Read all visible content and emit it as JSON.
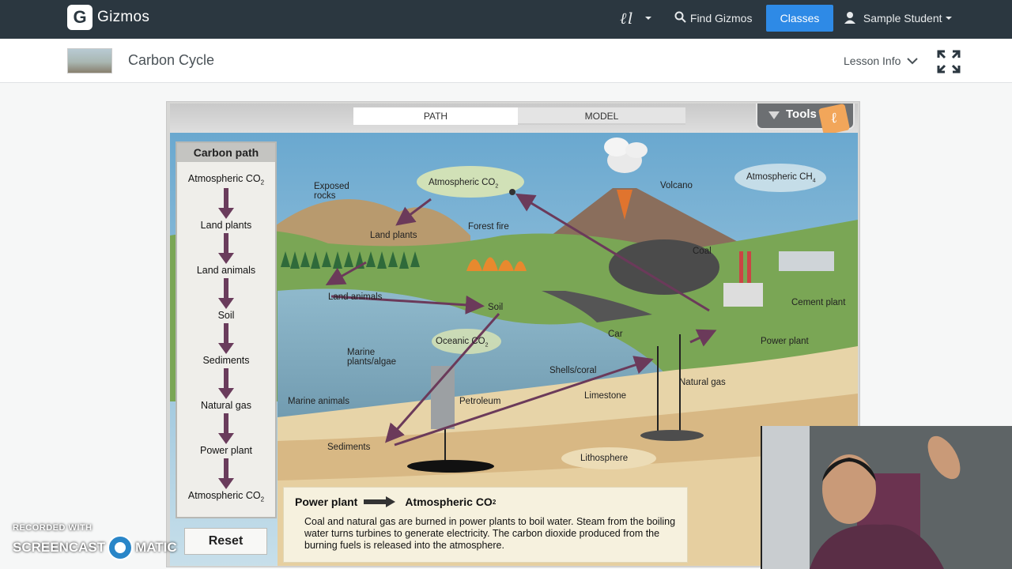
{
  "header": {
    "logo_letter": "G",
    "logo_text": "Gizmos",
    "find_label": "Find Gizmos",
    "classes_label": "Classes",
    "user_label": "Sample Student"
  },
  "subheader": {
    "title": "Carbon Cycle",
    "lesson_info": "Lesson Info"
  },
  "sim": {
    "tabs": {
      "path": "PATH",
      "model": "MODEL"
    },
    "tools_label": "Tools",
    "path_panel": {
      "title": "Carbon path",
      "items": [
        "Atmospheric CO",
        "Land plants",
        "Land animals",
        "Soil",
        "Sediments",
        "Natural gas",
        "Power plant",
        "Atmospheric CO"
      ],
      "sub2": "2"
    },
    "reset_label": "Reset",
    "labels": {
      "exposed_rocks_1": "Exposed",
      "exposed_rocks_2": "rocks",
      "atm_co2": "Atmospheric CO",
      "atm_ch4": "Atmospheric CH",
      "sub4": "4",
      "volcano": "Volcano",
      "land_plants": "Land plants",
      "forest_fire": "Forest fire",
      "coal": "Coal",
      "cement_plant": "Cement plant",
      "land_animals": "Land animals",
      "soil": "Soil",
      "oceanic_co2": "Oceanic CO",
      "car": "Car",
      "power_plant": "Power plant",
      "marine_plants_1": "Marine",
      "marine_plants_2": "plants/algae",
      "shells_coral": "Shells/coral",
      "natural_gas": "Natural gas",
      "limestone": "Limestone",
      "marine_animals": "Marine animals",
      "petroleum": "Petroleum",
      "sediments": "Sediments",
      "lithosphere": "Lithosphere"
    },
    "description": {
      "from": "Power plant",
      "to": "Atmospheric CO",
      "body": "Coal and natural gas are burned in power plants to boil water. Steam from the boiling water turns turbines to generate electricity. The carbon dioxide produced from the burning fuels is released into the atmosphere."
    }
  },
  "watermark": {
    "line1": "RECORDED WITH",
    "line2a": "SCREENCAST",
    "line2b": "MATIC"
  },
  "colors": {
    "topbar": "#2b3740",
    "classes": "#2e8ae6",
    "arrow": "#6b3a5a",
    "sky": "#9cc4d8",
    "water": "#7fa9bd"
  }
}
